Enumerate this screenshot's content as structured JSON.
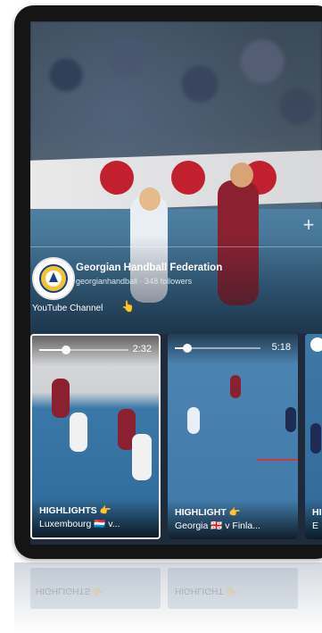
{
  "channel": {
    "name": "Georgian Handball Federation",
    "meta": "georgianhandball · 348 followers",
    "link_label": "YouTube Channel",
    "link_icon": "pointing-hand-emoji"
  },
  "cards": [
    {
      "duration": "2:32",
      "progress": 0.3,
      "title": "HIGHLIGHTS 👉",
      "subtitle": "Luxembourg 🇱🇺 v..."
    },
    {
      "duration": "5:18",
      "progress": 0.15,
      "title": "HIGHLIGHT 👉",
      "subtitle": "Georgia 🇬🇪 v Finla..."
    },
    {
      "duration": "",
      "progress": 0,
      "title": "HI",
      "subtitle": "E"
    }
  ],
  "reflection": {
    "left": "HIGHLIGHTS 👉",
    "right": "HIGHLIGHT 👉"
  },
  "colors": {
    "accent": "#c2202e",
    "card_active_border": "#f2f2f2"
  }
}
